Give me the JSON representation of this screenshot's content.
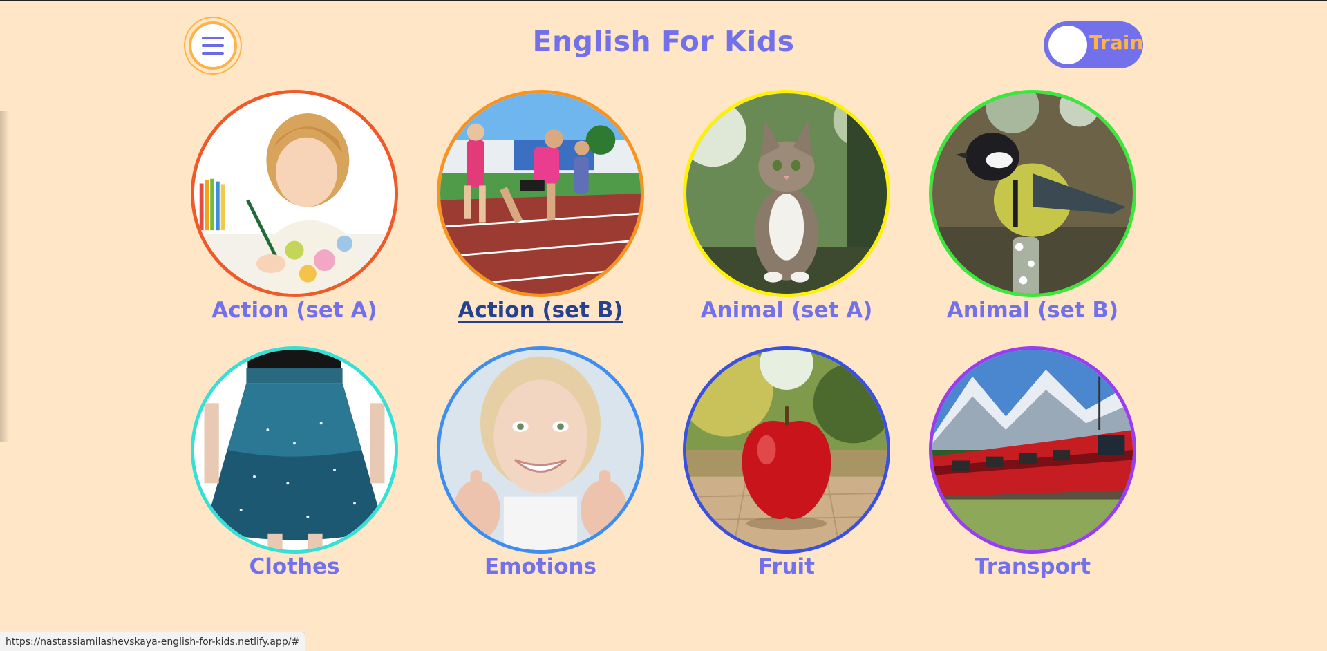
{
  "header": {
    "title": "English For Kids",
    "menu_icon": "hamburger-icon",
    "toggle_label": "Train"
  },
  "colors": {
    "background": "#ffe6c7",
    "accent": "#7271eb",
    "highlight": "#ffb347"
  },
  "categories": [
    {
      "label": "Action (set A)",
      "border": "#f05a28",
      "image": "girl-drawing"
    },
    {
      "label": "Action (set B)",
      "border": "#f7931e",
      "image": "kids-running-track",
      "hovered": true
    },
    {
      "label": "Animal (set A)",
      "border": "#fff200",
      "image": "cat"
    },
    {
      "label": "Animal (set B)",
      "border": "#39e83a",
      "image": "bird-titmouse"
    },
    {
      "label": "Clothes",
      "border": "#35e0d6",
      "image": "blue-skirt"
    },
    {
      "label": "Emotions",
      "border": "#3e8ef0",
      "image": "smiling-girl-thumbs-up"
    },
    {
      "label": "Fruit",
      "border": "#3a50e0",
      "image": "red-apple"
    },
    {
      "label": "Transport",
      "border": "#9a3cf0",
      "image": "red-train-mountains"
    }
  ],
  "status_bar": {
    "url": "https://nastassiamilashevskaya-english-for-kids.netlify.app/#"
  }
}
